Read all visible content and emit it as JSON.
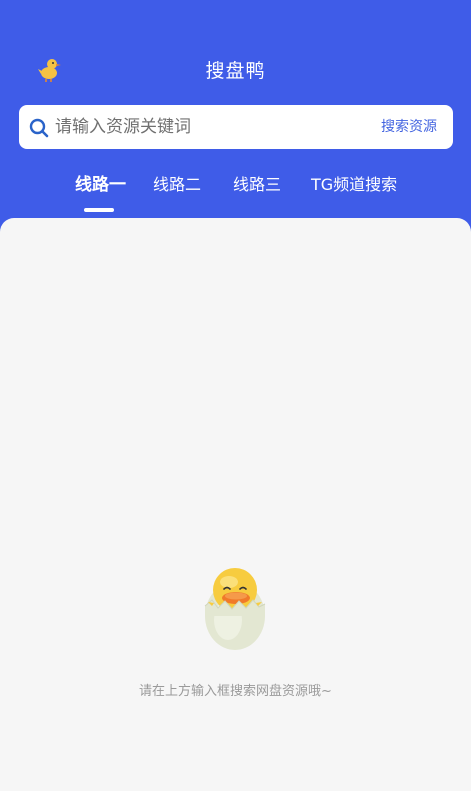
{
  "header": {
    "app_title": "搜盘鸭",
    "logo_icon": "duck-logo-icon"
  },
  "search": {
    "placeholder": "请输入资源关键词",
    "value": "",
    "button_label": "搜索资源",
    "icon": "search-icon"
  },
  "tabs": [
    {
      "label": "线路一",
      "active": true
    },
    {
      "label": "线路二",
      "active": false
    },
    {
      "label": "线路三",
      "active": false
    },
    {
      "label": "TG频道搜索",
      "active": false
    }
  ],
  "empty_state": {
    "icon": "duck-in-egg-illustration",
    "message": "请在上方输入框搜索网盘资源哦~"
  },
  "colors": {
    "primary": "#3F5CE8",
    "background": "#F6F6F6",
    "search_button": "#4364E0",
    "hint_text": "#9A9A9A"
  }
}
